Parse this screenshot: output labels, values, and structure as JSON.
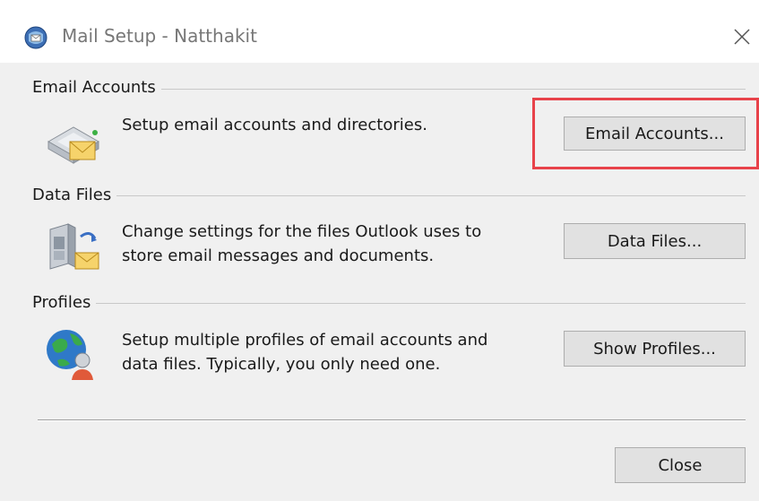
{
  "window": {
    "title": "Mail Setup - Natthakit",
    "close_icon": "close-icon",
    "app_icon": "mail-setup-icon"
  },
  "groups": {
    "email_accounts": {
      "title": "Email Accounts",
      "description": "Setup email accounts and directories.",
      "button_label": "Email Accounts...",
      "icon": "email-accounts-icon"
    },
    "data_files": {
      "title": "Data Files",
      "description_line1": "Change settings for the files Outlook uses to",
      "description_line2": "store email messages and documents.",
      "button_label": "Data Files...",
      "icon": "data-files-icon"
    },
    "profiles": {
      "title": "Profiles",
      "description_line1": "Setup multiple profiles of email accounts and",
      "description_line2": "data files. Typically, you only need one.",
      "button_label": "Show Profiles...",
      "icon": "profiles-icon"
    }
  },
  "footer": {
    "close_label": "Close"
  },
  "colors": {
    "highlight_border": "#e8424a",
    "dialog_background": "#f0f0f0",
    "button_background": "#e1e1e1"
  }
}
